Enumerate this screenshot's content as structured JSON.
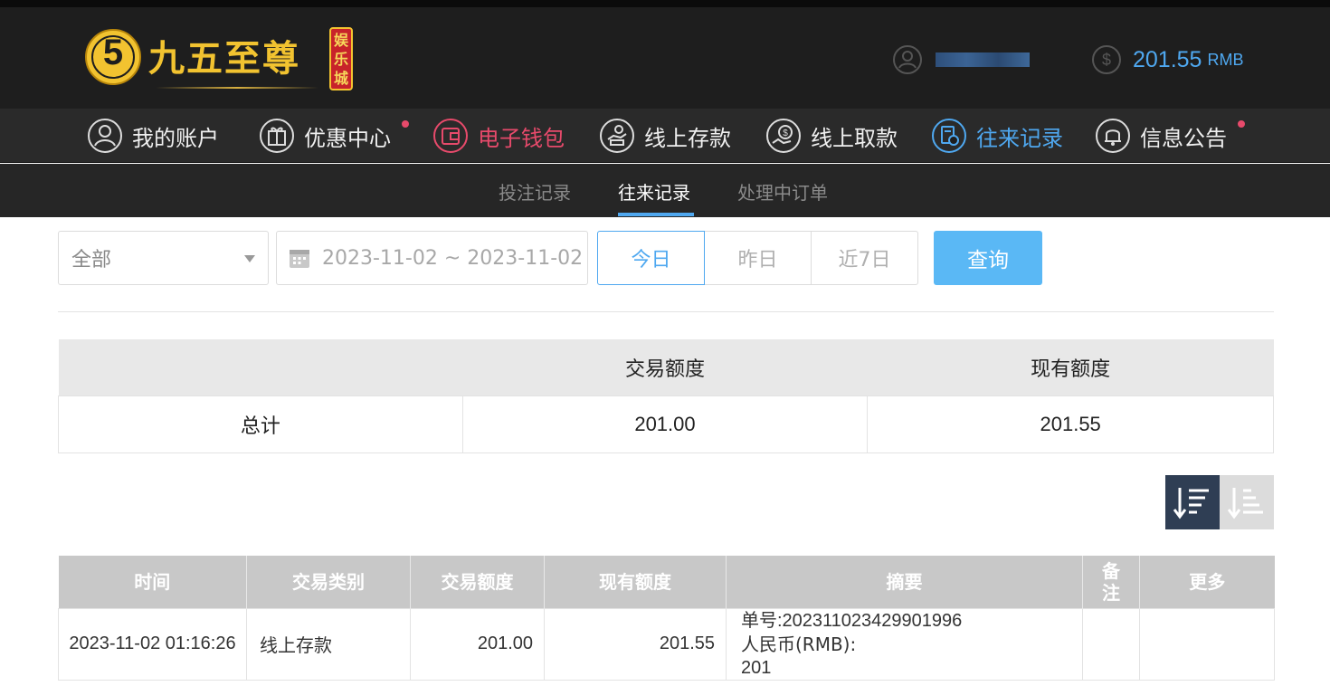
{
  "header": {
    "logo": {
      "mark": "5",
      "name": "九五至尊",
      "badge": "娱乐城"
    },
    "balance": {
      "amount": "201.55",
      "currency": "RMB"
    }
  },
  "nav": {
    "items": [
      {
        "label": "我的账户",
        "icon": "user-icon",
        "state": "normal"
      },
      {
        "label": "优惠中心",
        "icon": "gift-icon",
        "state": "normal",
        "dot": true
      },
      {
        "label": "电子钱包",
        "icon": "wallet-icon",
        "state": "highlight"
      },
      {
        "label": "线上存款",
        "icon": "deposit-icon",
        "state": "normal"
      },
      {
        "label": "线上取款",
        "icon": "withdraw-icon",
        "state": "normal"
      },
      {
        "label": "往来记录",
        "icon": "records-icon",
        "state": "active"
      },
      {
        "label": "信息公告",
        "icon": "bell-icon",
        "state": "normal",
        "dot": true
      }
    ]
  },
  "subnav": {
    "items": [
      {
        "label": "投注记录",
        "active": false
      },
      {
        "label": "往来记录",
        "active": true
      },
      {
        "label": "处理中订单",
        "active": false
      }
    ]
  },
  "filters": {
    "type_selected": "全部",
    "date_range": "2023-11-02 ~ 2023-11-02",
    "quick_dates": [
      {
        "label": "今日",
        "active": true
      },
      {
        "label": "昨日",
        "active": false
      },
      {
        "label": "近7日",
        "active": false
      }
    ],
    "query_label": "查询"
  },
  "summary": {
    "headers": [
      "",
      "交易额度",
      "现有额度"
    ],
    "row": {
      "label": "总计",
      "trade_amount": "201.00",
      "current_amount": "201.55"
    }
  },
  "sort": {
    "desc_icon": "sort-desc-icon",
    "asc_icon": "sort-asc-icon",
    "active": "desc"
  },
  "records": {
    "headers": [
      "时间",
      "交易类别",
      "交易额度",
      "现有额度",
      "摘要",
      "备注",
      "更多"
    ],
    "rows": [
      {
        "time": "2023-11-02 01:16:26",
        "type": "线上存款",
        "amount": "201.00",
        "balance": "201.55",
        "summary": [
          "单号:202311023429901996",
          "人民币(RMB):",
          "201"
        ],
        "remark": "",
        "more": ""
      }
    ]
  },
  "colors": {
    "accent": "#4fa8f0",
    "highlight": "#e74a6b",
    "gold": "#f2c330",
    "header_bg": "#1e1e1e"
  }
}
